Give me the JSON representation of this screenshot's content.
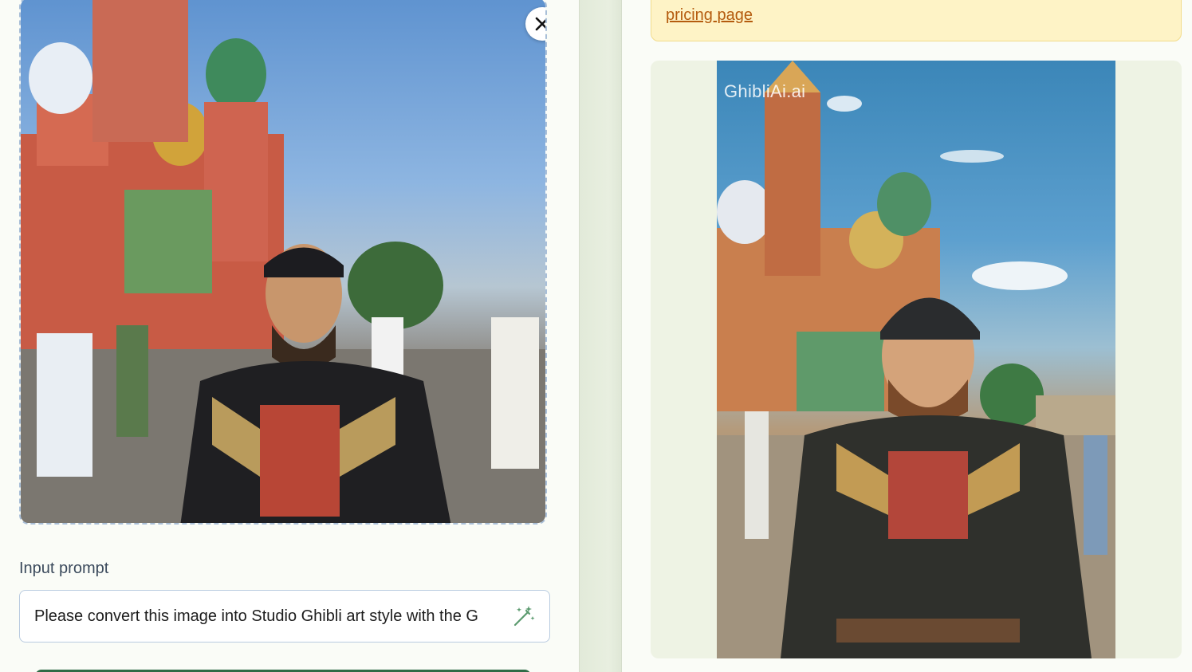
{
  "upload": {
    "image_alt": "Uploaded photo",
    "close_icon": "close-icon"
  },
  "prompt": {
    "label": "Input prompt",
    "value": "Please convert this image into Studio Ghibli art style with the G",
    "wand_icon": "magic-wand-icon"
  },
  "notice": {
    "link_text": "pricing page"
  },
  "result": {
    "watermark": "GhibliAi.ai"
  },
  "colors": {
    "notice_bg": "#fef3c6",
    "link": "#b45b0e",
    "generate_button": "#2f6b46",
    "upload_border": "#a9bfd8"
  }
}
